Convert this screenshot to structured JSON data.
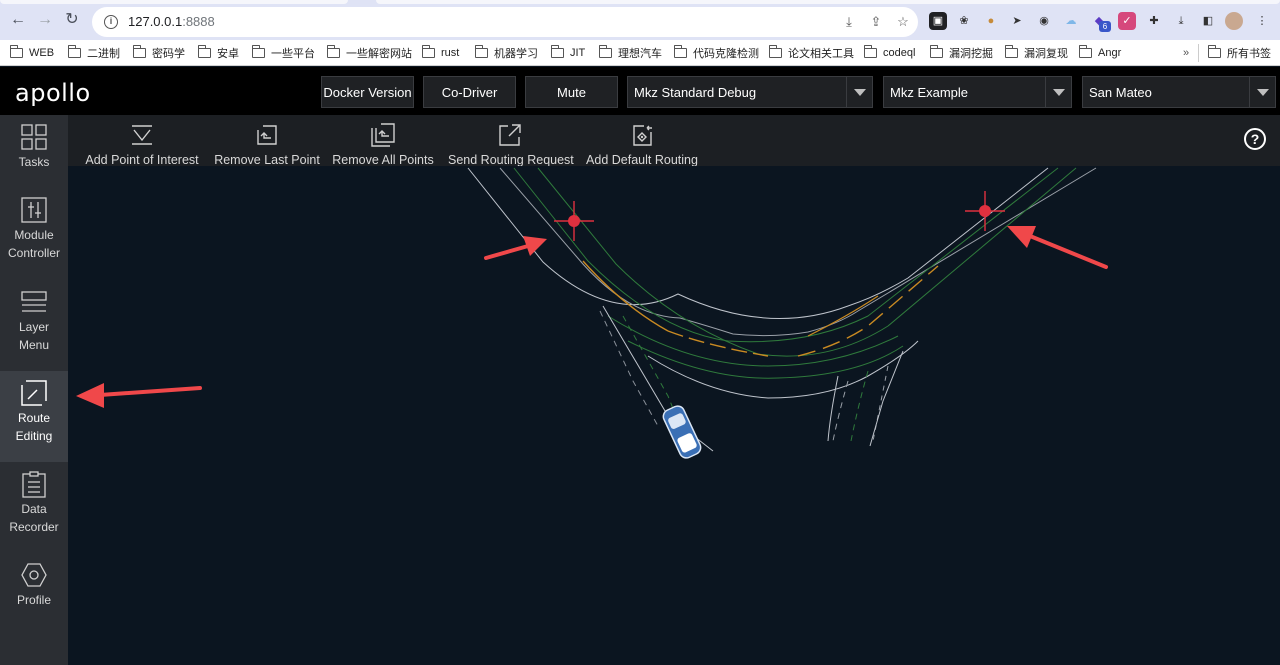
{
  "browser": {
    "url_host": "127.0.0.1",
    "url_port": ":8888",
    "bookmarks": [
      "WEB",
      "二进制",
      "密码学",
      "安卓",
      "一些平台",
      "一些解密网站",
      "rust",
      "机器学习",
      "JIT",
      "理想汽车",
      "代码克隆检测",
      "论文相关工具",
      "codeql",
      "漏洞挖掘",
      "漏洞复现",
      "Angr"
    ],
    "overflow_label": "»",
    "all_bookmarks": "所有书签",
    "ext_badge": "6"
  },
  "app": {
    "logo": "apollo",
    "buttons": {
      "docker_version": "Docker Version",
      "co_driver": "Co-Driver",
      "mute": "Mute"
    },
    "selects": {
      "mode": "Mkz Standard Debug",
      "vehicle": "Mkz Example",
      "map": "San Mateo"
    }
  },
  "sidebar": {
    "items": [
      {
        "label1": "Tasks",
        "label2": ""
      },
      {
        "label1": "Module",
        "label2": "Controller"
      },
      {
        "label1": "Layer",
        "label2": "Menu"
      },
      {
        "label1": "Route",
        "label2": "Editing"
      },
      {
        "label1": "Data",
        "label2": "Recorder"
      },
      {
        "label1": "Profile",
        "label2": ""
      }
    ],
    "active": "Route Editing"
  },
  "toolbar": {
    "add_poi": "Add Point of Interest",
    "remove_last": "Remove Last Point",
    "remove_all": "Remove All Points",
    "send_routing": "Send Routing Request",
    "add_default": "Add Default Routing",
    "help": "?"
  },
  "colors": {
    "marker": "#e0303f",
    "annotation_arrow": "#f0484a",
    "lane_boundary": "#bfc4cc",
    "lane_yellow": "#c98a22",
    "lane_green": "#2f7a3c"
  }
}
